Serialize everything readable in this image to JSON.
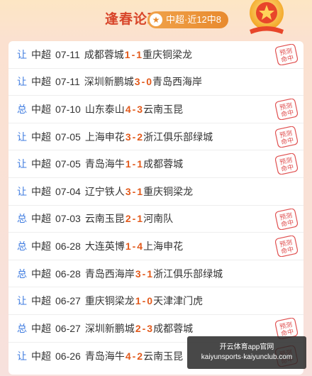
{
  "header": {
    "title": "逢春论球",
    "record_badge": "中超·近12中8"
  },
  "colors": {
    "accent": "#d8452a",
    "score": "#e25a1c",
    "type_label": "#3e7be0",
    "stamp": "#e05050"
  },
  "stamp_text": [
    "预测",
    "命中"
  ],
  "matches": [
    {
      "type": "让",
      "league": "中超",
      "date": "07-11",
      "home": "成都蓉城",
      "home_score": "1",
      "sep": "-",
      "away_score": "1",
      "away": "重庆铜梁龙",
      "hit": true
    },
    {
      "type": "让",
      "league": "中超",
      "date": "07-11",
      "home": "深圳新鹏城",
      "home_score": "3",
      "sep": "-",
      "away_score": "0",
      "away": "青岛西海岸",
      "hit": false
    },
    {
      "type": "总",
      "league": "中超",
      "date": "07-10",
      "home": "山东泰山",
      "home_score": "4",
      "sep": "-",
      "away_score": "3",
      "away": "云南玉昆",
      "hit": true
    },
    {
      "type": "让",
      "league": "中超",
      "date": "07-05",
      "home": "上海申花",
      "home_score": "3",
      "sep": "-",
      "away_score": "2",
      "away": "浙江俱乐部绿城",
      "hit": true
    },
    {
      "type": "让",
      "league": "中超",
      "date": "07-05",
      "home": "青岛海牛",
      "home_score": "1",
      "sep": "-",
      "away_score": "1",
      "away": "成都蓉城",
      "hit": true
    },
    {
      "type": "让",
      "league": "中超",
      "date": "07-04",
      "home": "辽宁铁人",
      "home_score": "3",
      "sep": "-",
      "away_score": "1",
      "away": "重庆铜梁龙",
      "hit": false
    },
    {
      "type": "总",
      "league": "中超",
      "date": "07-03",
      "home": "云南玉昆",
      "home_score": "2",
      "sep": "-",
      "away_score": "1",
      "away": "河南队",
      "hit": true
    },
    {
      "type": "总",
      "league": "中超",
      "date": "06-28",
      "home": "大连英博",
      "home_score": "1",
      "sep": "-",
      "away_score": "4",
      "away": "上海申花",
      "hit": true
    },
    {
      "type": "总",
      "league": "中超",
      "date": "06-28",
      "home": "青岛西海岸",
      "home_score": "3",
      "sep": "-",
      "away_score": "1",
      "away": "浙江俱乐部绿城",
      "hit": false
    },
    {
      "type": "让",
      "league": "中超",
      "date": "06-27",
      "home": "重庆铜梁龙",
      "home_score": "1",
      "sep": "-",
      "away_score": "0",
      "away": "天津津门虎",
      "hit": false
    },
    {
      "type": "总",
      "league": "中超",
      "date": "06-27",
      "home": "深圳新鹏城",
      "home_score": "2",
      "sep": "-",
      "away_score": "3",
      "away": "成都蓉城",
      "hit": true
    },
    {
      "type": "让",
      "league": "中超",
      "date": "06-26",
      "home": "青岛海牛",
      "home_score": "4",
      "sep": "-",
      "away_score": "2",
      "away": "云南玉昆",
      "hit": true
    }
  ],
  "watermark": {
    "line1": "开云体育app官网",
    "line2": "kaiyunsports·kaiyunclub.com"
  }
}
